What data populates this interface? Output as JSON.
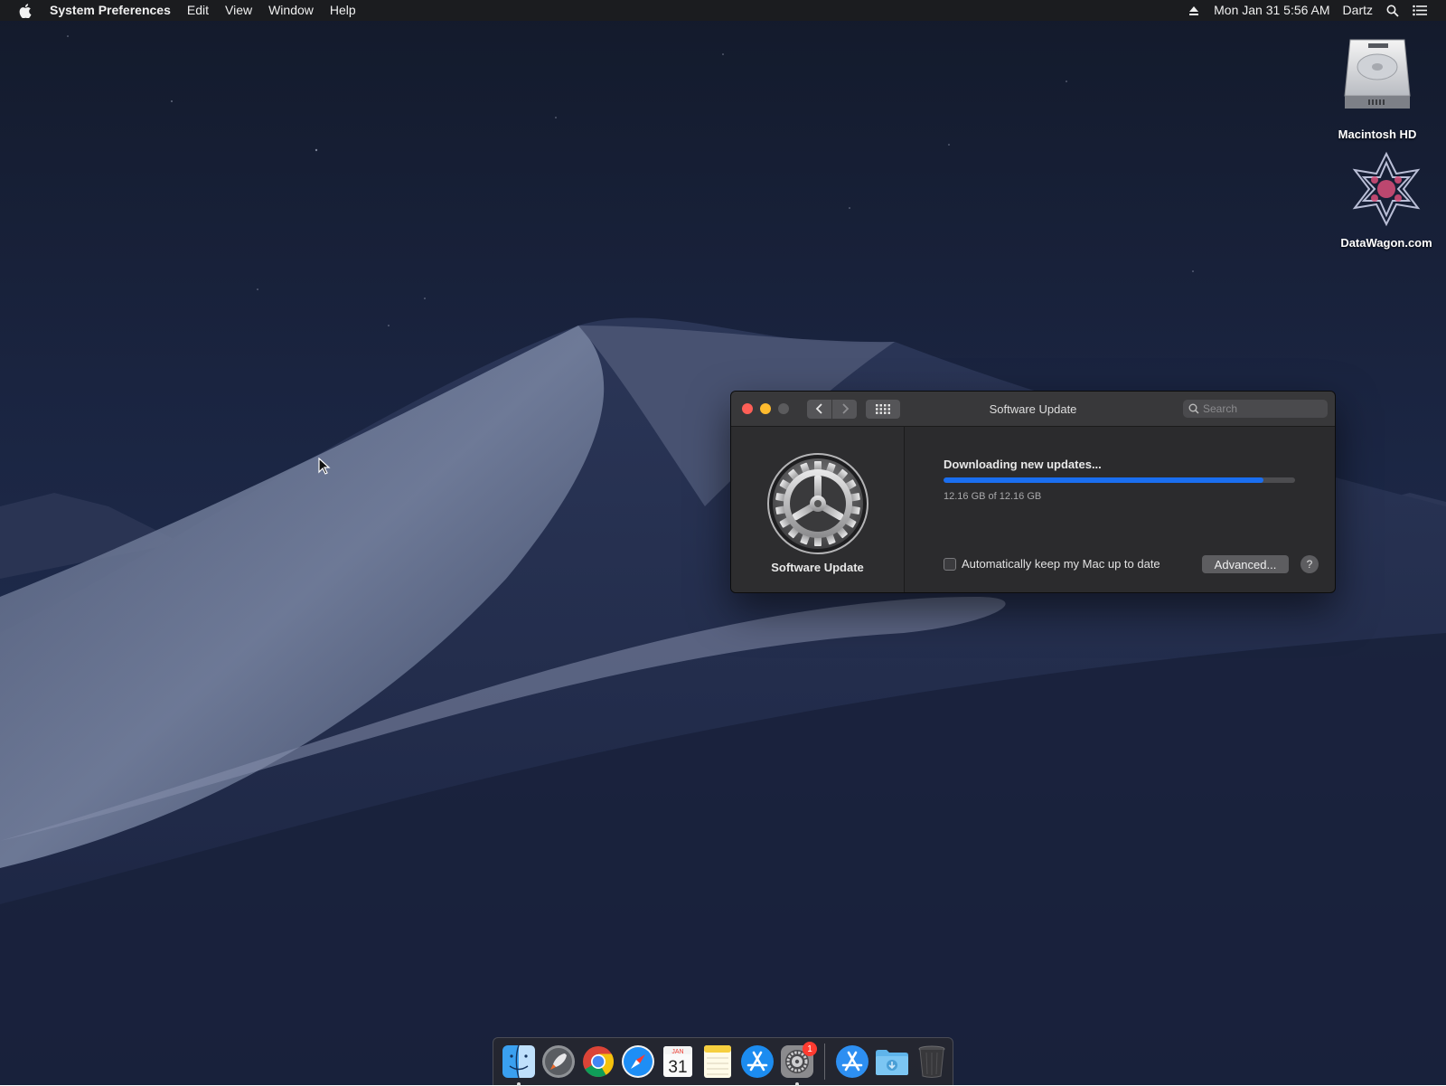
{
  "menubar": {
    "app_name": "System Preferences",
    "menus": [
      "Edit",
      "View",
      "Window",
      "Help"
    ],
    "datetime": "Mon Jan 31  5:56 AM",
    "user": "Dartz"
  },
  "desktop_icons": [
    {
      "label": "Macintosh HD",
      "icon": "hard-drive-icon"
    },
    {
      "label": "DataWagon.com",
      "icon": "datawagon-logo-icon"
    }
  ],
  "window": {
    "title": "Software Update",
    "search_placeholder": "Search",
    "pane_name": "Software Update",
    "status": "Downloading new updates...",
    "progress_fraction": 0.91,
    "size_text": "12.16 GB of 12.16 GB",
    "auto_update_label": "Automatically keep my Mac up to date",
    "auto_update_checked": false,
    "advanced_label": "Advanced...",
    "help_label": "?"
  },
  "dock": {
    "apps": [
      "finder-icon",
      "launchpad-icon",
      "chrome-icon",
      "safari-icon",
      "calendar-icon",
      "notes-icon",
      "app-store-icon",
      "system-preferences-icon"
    ],
    "calendar": {
      "month": "JAN",
      "day": "31"
    },
    "system_preferences_badge": "1",
    "others": [
      "app-store-icon",
      "downloads-folder-icon",
      "trash-icon"
    ]
  },
  "colors": {
    "accent": "#1a6ef0",
    "close": "#fe5f57",
    "minimize": "#febb2e",
    "badge": "#ff3b30"
  }
}
